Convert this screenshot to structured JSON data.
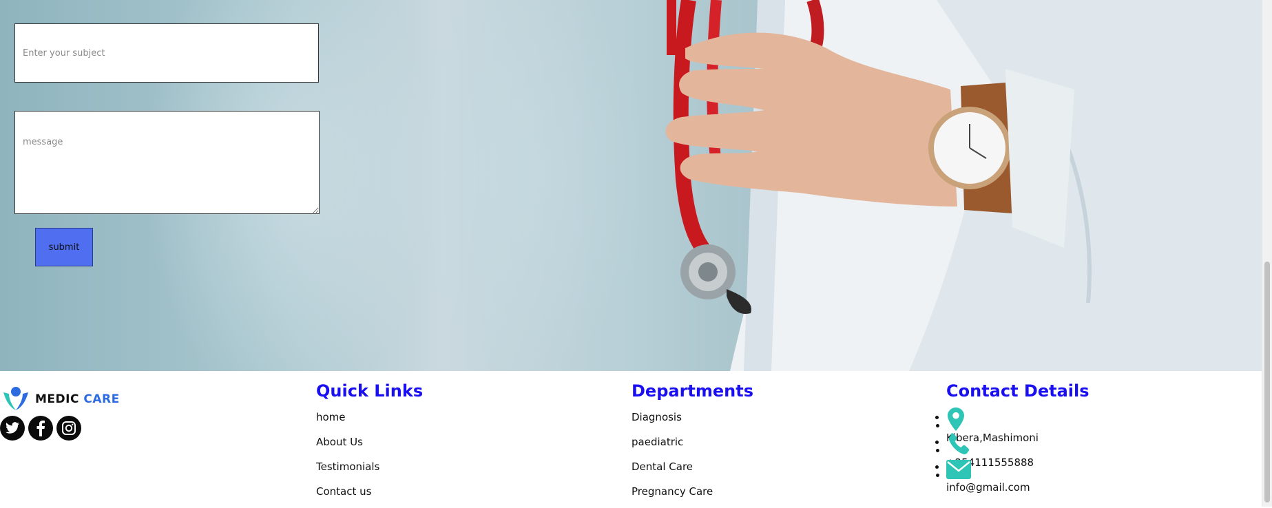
{
  "form": {
    "subject_placeholder": "Enter your subject",
    "message_placeholder": "message",
    "submit_label": "submit"
  },
  "footer": {
    "brand": {
      "name_part1": "MEDIC",
      "name_part2": "CARE"
    },
    "social_icons": [
      "twitter-icon",
      "facebook-icon",
      "instagram-icon"
    ],
    "quick_links": {
      "title": "Quick Links",
      "items": [
        "home",
        "About Us",
        "Testimonials",
        "Contact us"
      ]
    },
    "departments": {
      "title": "Departments",
      "items": [
        "Diagnosis",
        "paediatric",
        "Dental Care",
        "Pregnancy Care"
      ]
    },
    "contact": {
      "title": "Contact Details",
      "items": [
        {
          "icon": "location-pin-icon",
          "text": "Kibera,Mashimoni"
        },
        {
          "icon": "phone-icon",
          "text": "+254111555888"
        },
        {
          "icon": "mail-icon",
          "text": "info@gmail.com"
        }
      ]
    }
  },
  "colors": {
    "heading": "#1a0ff0",
    "submit_bg": "#4f6ff0",
    "contact_icon": "#2ec4b6",
    "brand_accent": "#2d6be0"
  }
}
